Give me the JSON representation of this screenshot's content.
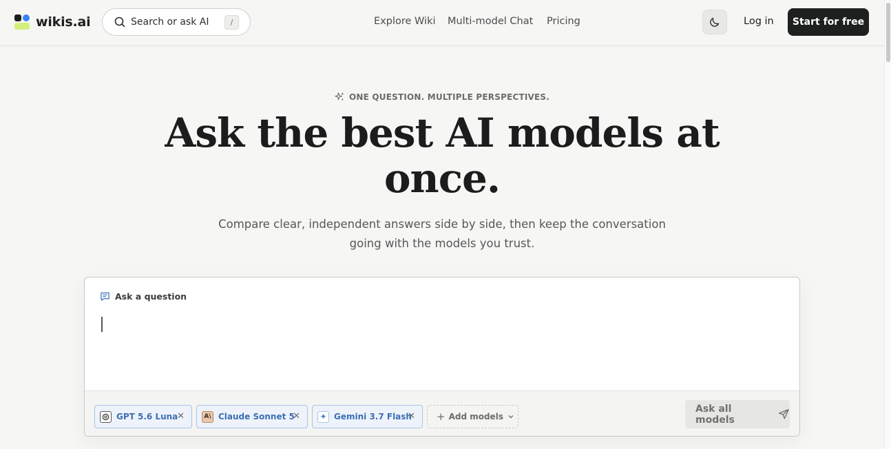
{
  "header": {
    "logo_text": "wikis.ai",
    "search_placeholder": "Search or ask AI",
    "search_shortcut": "/",
    "nav": [
      "Explore Wiki",
      "Multi-model Chat",
      "Pricing"
    ],
    "login_label": "Log in",
    "cta_label": "Start for free"
  },
  "hero": {
    "eyebrow": "ONE QUESTION. MULTIPLE PERSPECTIVES.",
    "headline_line1": "Ask the best AI models at",
    "headline_line2": "once.",
    "subtitle_line1": "Compare clear, independent answers side by side, then keep the conversation",
    "subtitle_line2": "going with the models you trust."
  },
  "question_card": {
    "label": "Ask a question",
    "input_value": "",
    "models": [
      {
        "name": "GPT 5.6 Luna",
        "icon": "openai-icon"
      },
      {
        "name": "Claude Sonnet 5",
        "icon": "anthropic-icon"
      },
      {
        "name": "Gemini 3.7 Flash",
        "icon": "gemini-icon"
      }
    ],
    "add_models_label": "Add models",
    "submit_label": "Ask all models"
  },
  "colors": {
    "background": "#f6f6f4",
    "primary_dark": "#1d201f",
    "chip_blue": "#3c6fb6",
    "logo_lime": "#d4f07a",
    "logo_blue": "#3b82f6"
  }
}
